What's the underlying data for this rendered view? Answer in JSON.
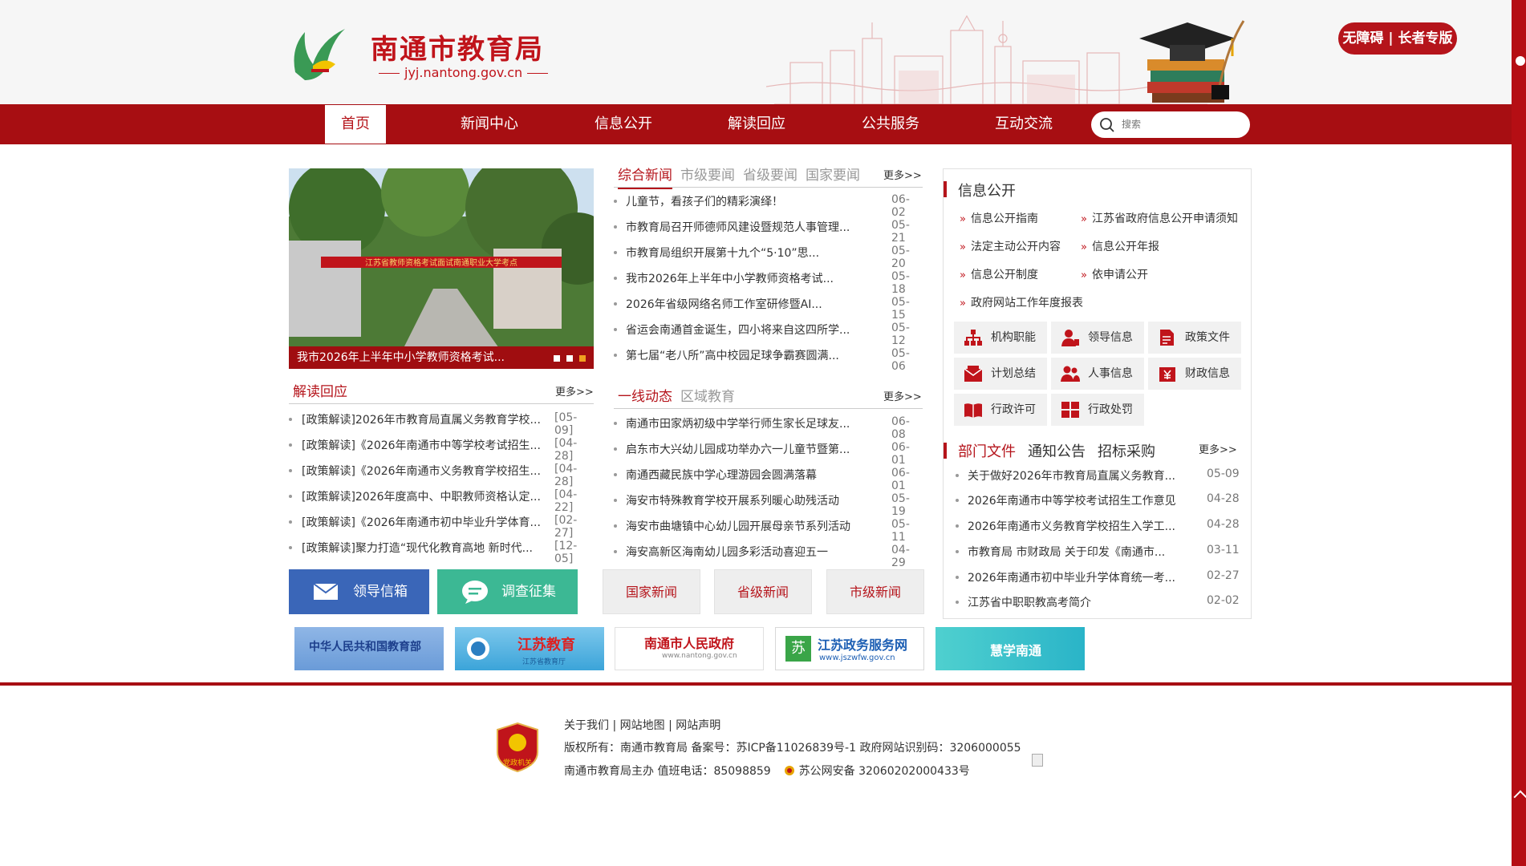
{
  "header": {
    "title": "南通市教育局",
    "domain": "jyj.nantong.gov.cn",
    "access_button": "无障碍 | 长者专版"
  },
  "nav": {
    "items": [
      "首页",
      "新闻中心",
      "信息公开",
      "解读回应",
      "公共服务",
      "互动交流"
    ],
    "active": "首页",
    "search_placeholder": "搜索"
  },
  "slideshow": {
    "banner_text": "江苏省教师资格考试面试南通职业大学考点",
    "caption": "我市2026年上半年中小学教师资格考试..."
  },
  "news": {
    "tabs": [
      "综合新闻",
      "市级要闻",
      "省级要闻",
      "国家要闻"
    ],
    "more": "更多>>",
    "items": [
      {
        "title": "儿童节，看孩子们的精彩演绎！",
        "date": "06-02"
      },
      {
        "title": "市教育局召开师德师风建设暨规范人事管理...",
        "date": "05-21"
      },
      {
        "title": "市教育局组织开展第十九个“5·10”思...",
        "date": "05-20"
      },
      {
        "title": "我市2026年上半年中小学教师资格考试...",
        "date": "05-18"
      },
      {
        "title": "2026年省级网络名师工作室研修暨AI...",
        "date": "05-15"
      },
      {
        "title": "省运会南通首金诞生，四小将来自这四所学...",
        "date": "05-12"
      },
      {
        "title": "第七届“老八所”高中校园足球争霸赛圆满...",
        "date": "05-06"
      }
    ]
  },
  "jiedu": {
    "title": "解读回应",
    "more": "更多>>",
    "items": [
      {
        "title": "[政策解读]2026年市教育局直属义务教育学校...",
        "date": "[05-09]"
      },
      {
        "title": "[政策解读]《2026年南通市中等学校考试招生...",
        "date": "[04-28]"
      },
      {
        "title": "[政策解读]《2026年南通市义务教育学校招生...",
        "date": "[04-28]"
      },
      {
        "title": "[政策解读]2026年度高中、中职教师资格认定...",
        "date": "[04-22]"
      },
      {
        "title": "[政策解读]《2026年南通市初中毕业升学体育...",
        "date": "[02-27]"
      },
      {
        "title": "[政策解读]聚力打造“现代化教育高地 新时代...",
        "date": "[12-05]"
      }
    ]
  },
  "yixian": {
    "tabs": [
      "一线动态",
      "区域教育"
    ],
    "more": "更多>>",
    "items": [
      {
        "title": "南通市田家炳初级中学举行师生家长足球友...",
        "date": "06-08"
      },
      {
        "title": "启东市大兴幼儿园成功举办六一儿童节暨第...",
        "date": "06-01"
      },
      {
        "title": "南通西藏民族中学心理游园会圆满落幕",
        "date": "06-01"
      },
      {
        "title": "海安市特殊教育学校开展系列暖心助残活动",
        "date": "05-19"
      },
      {
        "title": "海安市曲塘镇中心幼儿园开展母亲节系列活动",
        "date": "05-11"
      },
      {
        "title": "海安高新区海南幼儿园多彩活动喜迎五一",
        "date": "04-29"
      }
    ]
  },
  "buttons": {
    "mailbox": "领导信箱",
    "survey": "调查征集",
    "national_news": "国家新闻",
    "provincial_news": "省级新闻",
    "city_news": "市级新闻"
  },
  "links": [
    {
      "label": "中华人民共和国教育部"
    },
    {
      "label": "江苏教育",
      "sub": "江苏省教育厅"
    },
    {
      "label": "南通市人民政府",
      "sub": "www.nantong.gov.cn"
    },
    {
      "label": "江苏政务服务网",
      "sub": "www.jszwfw.gov.cn"
    },
    {
      "label": "慧学南通"
    }
  ],
  "info_public": {
    "title": "信息公开",
    "links": [
      "信息公开指南",
      "江苏省政府信息公开申请须知",
      "法定主动公开内容",
      "信息公开年报",
      "信息公开制度",
      "依申请公开",
      "政府网站工作年度报表"
    ],
    "grid": [
      {
        "label": "机构职能",
        "icon": "org-chart-icon"
      },
      {
        "label": "领导信息",
        "icon": "leader-icon"
      },
      {
        "label": "政策文件",
        "icon": "document-icon"
      },
      {
        "label": "计划总结",
        "icon": "envelope-icon"
      },
      {
        "label": "人事信息",
        "icon": "people-icon"
      },
      {
        "label": "财政信息",
        "icon": "finance-icon"
      },
      {
        "label": "行政许可",
        "icon": "book-icon"
      },
      {
        "label": "行政处罚",
        "icon": "grid-icon"
      }
    ]
  },
  "dept": {
    "tabs": [
      "部门文件",
      "通知公告",
      "招标采购"
    ],
    "more": "更多>>",
    "items": [
      {
        "title": "关于做好2026年市教育局直属义务教育...",
        "date": "05-09"
      },
      {
        "title": "2026年南通市中等学校考试招生工作意见",
        "date": "04-28"
      },
      {
        "title": "2026年南通市义务教育学校招生入学工...",
        "date": "04-28"
      },
      {
        "title": "市教育局 市财政局 关于印发《南通市...",
        "date": "03-11"
      },
      {
        "title": "2026年南通市初中毕业升学体育统一考...",
        "date": "02-27"
      },
      {
        "title": "江苏省中职职教高考简介",
        "date": "02-02"
      }
    ]
  },
  "footer": {
    "links_line": "关于我们 | 网站地图 | 网站声明",
    "copyright": "版权所有：南通市教育局  备案号：苏ICP备11026839号-1  政府网站识别码：3206000055",
    "host": "南通市教育局主办 值班电话：85098859",
    "police": "苏公网安备 32060202000433号",
    "emblem_text": "党政机关"
  },
  "colors": {
    "brand_red": "#a70e12",
    "accent_red": "#c0141b",
    "mail_blue": "#3a66b8",
    "survey_green": "#3cb894"
  }
}
